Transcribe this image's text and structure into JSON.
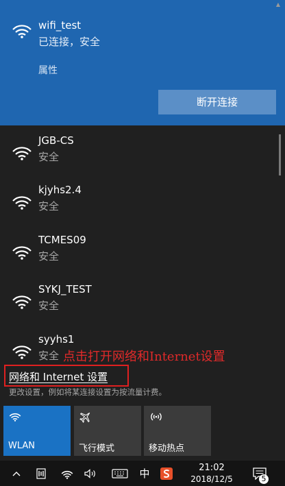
{
  "connected_network": {
    "ssid": "wifi_test",
    "status": "已连接，安全",
    "properties_label": "属性",
    "disconnect_label": "断开连接"
  },
  "networks": [
    {
      "ssid": "JGB-CS",
      "security": "安全"
    },
    {
      "ssid": "kjyhs2.4",
      "security": "安全"
    },
    {
      "ssid": "TCMES09",
      "security": "安全"
    },
    {
      "ssid": "SYKJ_TEST",
      "security": "安全"
    },
    {
      "ssid": "syyhs1",
      "security": "安全"
    }
  ],
  "annotation": "点击打开网络和Internet设置",
  "settings": {
    "link_label": "网络和 Internet 设置",
    "description": "更改设置，例如将某连接设置为按流量计费。"
  },
  "quick_actions": [
    {
      "label": "WLAN",
      "icon": "wifi-icon",
      "active": true
    },
    {
      "label": "飞行模式",
      "icon": "airplane-icon",
      "active": false
    },
    {
      "label": "移动热点",
      "icon": "hotspot-icon",
      "active": false
    }
  ],
  "taskbar": {
    "ime_label": "中",
    "time": "21:02",
    "date": "2018/12/5",
    "notification_count": "5"
  },
  "colors": {
    "accent": "#1a72c4",
    "connected_bg": "#1f66b0",
    "annotation_red": "#e02a2a"
  }
}
